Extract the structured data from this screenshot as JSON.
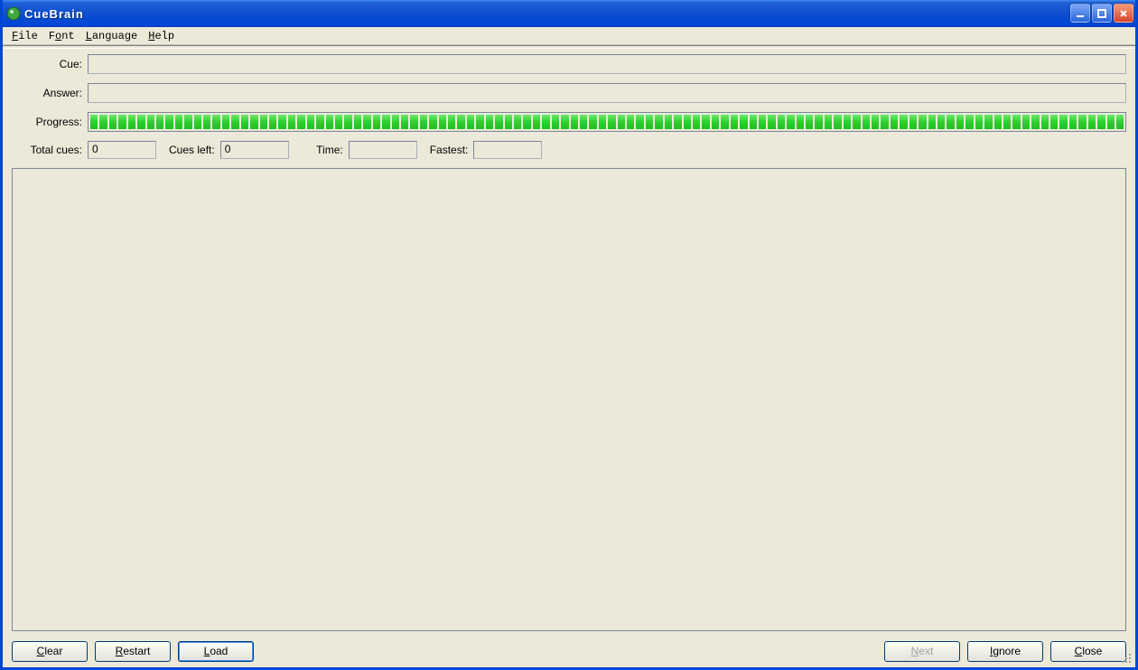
{
  "window": {
    "title": "CueBrain"
  },
  "menu": {
    "file": "File",
    "font": "Font",
    "language": "Language",
    "help": "Help"
  },
  "labels": {
    "cue": "Cue:",
    "answer": "Answer:",
    "progress": "Progress:",
    "total_cues": "Total cues:",
    "cues_left": "Cues left:",
    "time": "Time:",
    "fastest": "Fastest:"
  },
  "fields": {
    "cue": "",
    "answer": "",
    "total_cues": "0",
    "cues_left": "0",
    "time": "",
    "fastest": ""
  },
  "progress": {
    "segments": 110,
    "full": true
  },
  "buttons": {
    "clear": "Clear",
    "restart": "Restart",
    "load": "Load",
    "next": "Next",
    "ignore": "Ignore",
    "close": "Close"
  }
}
